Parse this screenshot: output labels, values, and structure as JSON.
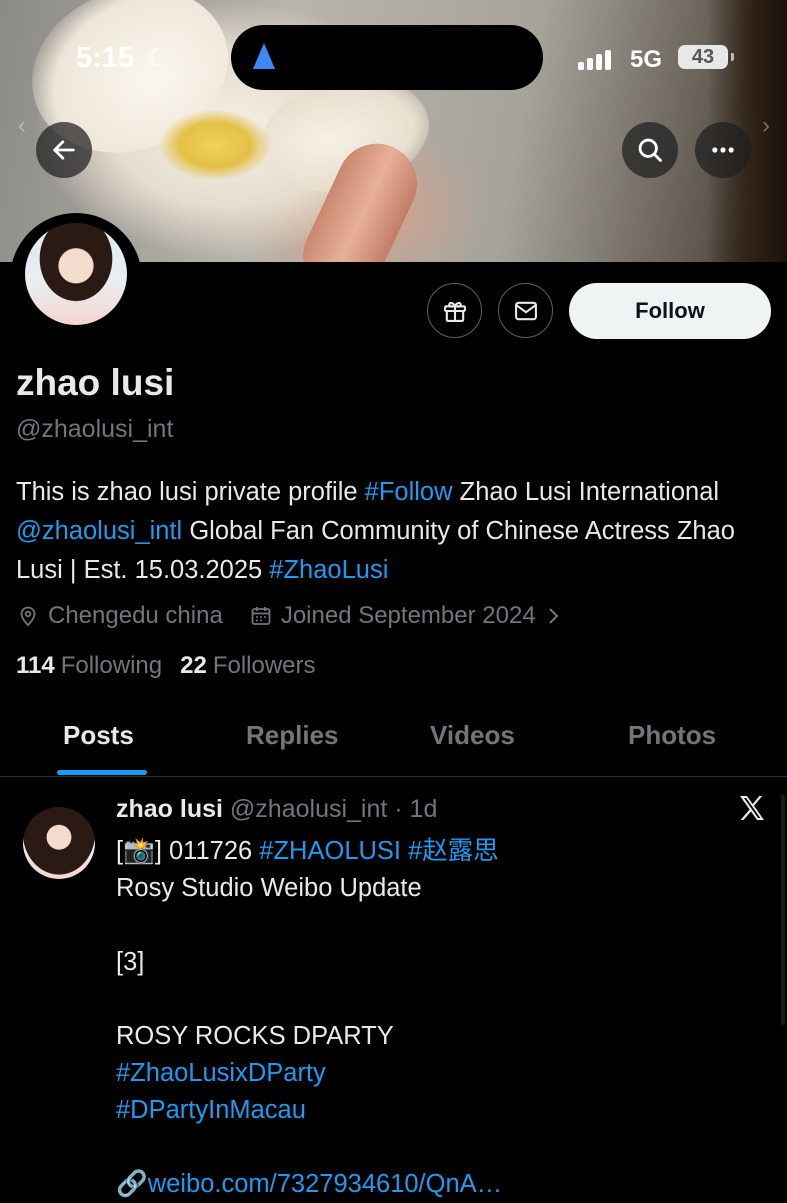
{
  "status_bar": {
    "time": "5:15",
    "network": "5G",
    "battery": "43"
  },
  "profile": {
    "name": "zhao lusi",
    "handle": "@zhaolusi_int",
    "follow_label": "Follow",
    "bio": {
      "part1": "This is zhao lusi private profile ",
      "tag1": "#Follow",
      "part2": " Zhao Lusi International ",
      "mention": "@zhaolusi_intl",
      "part3": " Global Fan Community of Chinese Actress Zhao Lusi | Est. 15.03.2025 ",
      "tag2": "#ZhaoLusi"
    },
    "location": "Chengedu china",
    "joined": "Joined September 2024",
    "following_count": "114",
    "following_label": "Following",
    "followers_count": "22",
    "followers_label": "Followers"
  },
  "tabs": [
    "Posts",
    "Replies",
    "Videos",
    "Photos"
  ],
  "post": {
    "author": "zhao lusi",
    "meta": "@zhaolusi_int · 1d",
    "line1_prefix": "[📸] 011726 ",
    "line1_tags": "#ZHAOLUSI #赵露思",
    "line2": "Rosy Studio Weibo Update",
    "line3": "[3]",
    "line4": "ROSY ROCKS DPARTY",
    "tag1": "#ZhaoLusixDParty",
    "tag2": "#DPartyInMacau",
    "link_emoji": "🔗",
    "link": "weibo.com/7327934610/QnA…"
  },
  "colors": {
    "accent": "#1d9bf0",
    "muted": "#71767b",
    "text": "#e7e9ea",
    "background": "#000000"
  }
}
